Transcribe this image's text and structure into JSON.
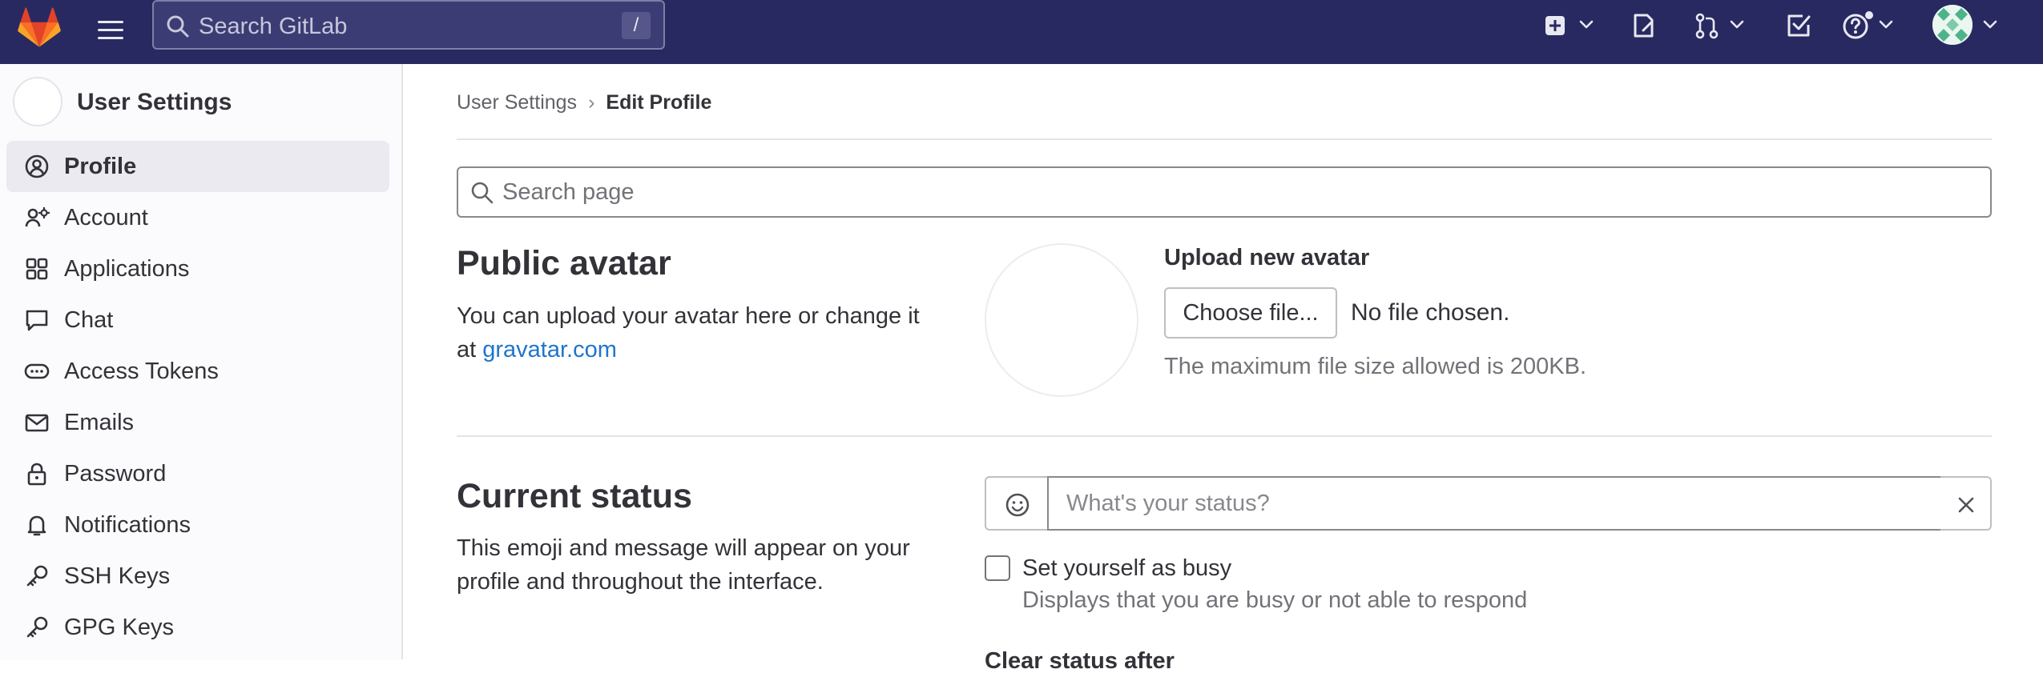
{
  "topbar": {
    "search_placeholder": "Search GitLab",
    "search_shortcut": "/",
    "icons": [
      "gitlab-logo",
      "hamburger-menu-icon",
      "search-icon",
      "new-item-icon",
      "issues-icon",
      "merge-request-icon",
      "todo-icon",
      "help-icon",
      "user-avatar"
    ],
    "background_color": "#292961"
  },
  "sidebar": {
    "title": "User Settings",
    "items": [
      {
        "label": "Profile",
        "icon": "profile-icon",
        "active": true
      },
      {
        "label": "Account",
        "icon": "account-icon",
        "active": false
      },
      {
        "label": "Applications",
        "icon": "applications-icon",
        "active": false
      },
      {
        "label": "Chat",
        "icon": "chat-icon",
        "active": false
      },
      {
        "label": "Access Tokens",
        "icon": "token-icon",
        "active": false
      },
      {
        "label": "Emails",
        "icon": "mail-icon",
        "active": false
      },
      {
        "label": "Password",
        "icon": "lock-icon",
        "active": false
      },
      {
        "label": "Notifications",
        "icon": "bell-icon",
        "active": false
      },
      {
        "label": "SSH Keys",
        "icon": "key-icon",
        "active": false
      },
      {
        "label": "GPG Keys",
        "icon": "key-icon",
        "active": false
      }
    ]
  },
  "breadcrumb": {
    "parent": "User Settings",
    "current": "Edit Profile"
  },
  "page_search": {
    "placeholder": "Search page"
  },
  "public_avatar": {
    "heading": "Public avatar",
    "description": "You can upload your avatar here or change it at ",
    "link_text": "gravatar.com",
    "upload_label": "Upload new avatar",
    "choose_button": "Choose file...",
    "no_file": "No file chosen.",
    "max_size": "The maximum file size allowed is 200KB."
  },
  "current_status": {
    "heading": "Current status",
    "description": "This emoji and message will appear on your profile and throughout the interface.",
    "input_placeholder": "What's your status?",
    "busy_label": "Set yourself as busy",
    "busy_help": "Displays that you are busy or not able to respond",
    "clear_after_label": "Clear status after"
  },
  "colors": {
    "link": "#1f75cb",
    "active_nav": "#ebeaf1",
    "accent_orange": "#fc6d26"
  }
}
